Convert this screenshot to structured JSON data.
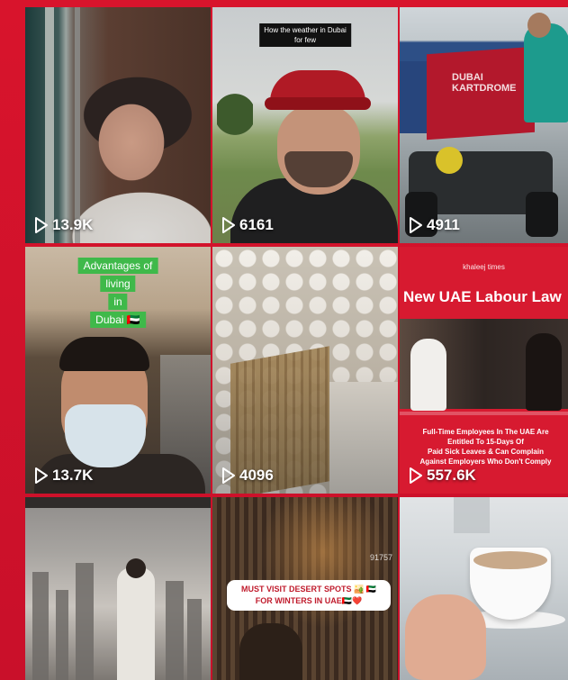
{
  "videos": [
    {
      "views": "13.9K",
      "caption": ""
    },
    {
      "views": "6161",
      "caption": "How the weather in Dubai\nfor few"
    },
    {
      "views": "4911",
      "caption": "DUBAI KARTDROME"
    },
    {
      "views": "13.7K",
      "caption_lines": [
        "Advantages of",
        "living",
        "in",
        "Dubai 🇦🇪"
      ]
    },
    {
      "views": "4096",
      "caption": ""
    },
    {
      "views": "557.6K",
      "logo": "khaleej times",
      "headline": "New UAE Labour Law",
      "body": "Full-Time Employees In The UAE Are\nEntitled To 15-Days Of\nPaid Sick Leaves & Can Complain\nAgainst Employers Who Don't Comply"
    },
    {
      "views": "",
      "caption": ""
    },
    {
      "views": "",
      "caption": "MUST VISIT DESERT SPOTS 🏜️ 🇦🇪\nFOR WINTERS IN UAE🇦🇪❤️",
      "sign": "91757"
    },
    {
      "views": "",
      "caption": ""
    }
  ],
  "colors": {
    "background": "#d5132a",
    "view_text": "#ffffff",
    "headline_card": "#d71a30",
    "caption_green": "#3fb94a"
  },
  "icons": {
    "play": "play-icon"
  }
}
